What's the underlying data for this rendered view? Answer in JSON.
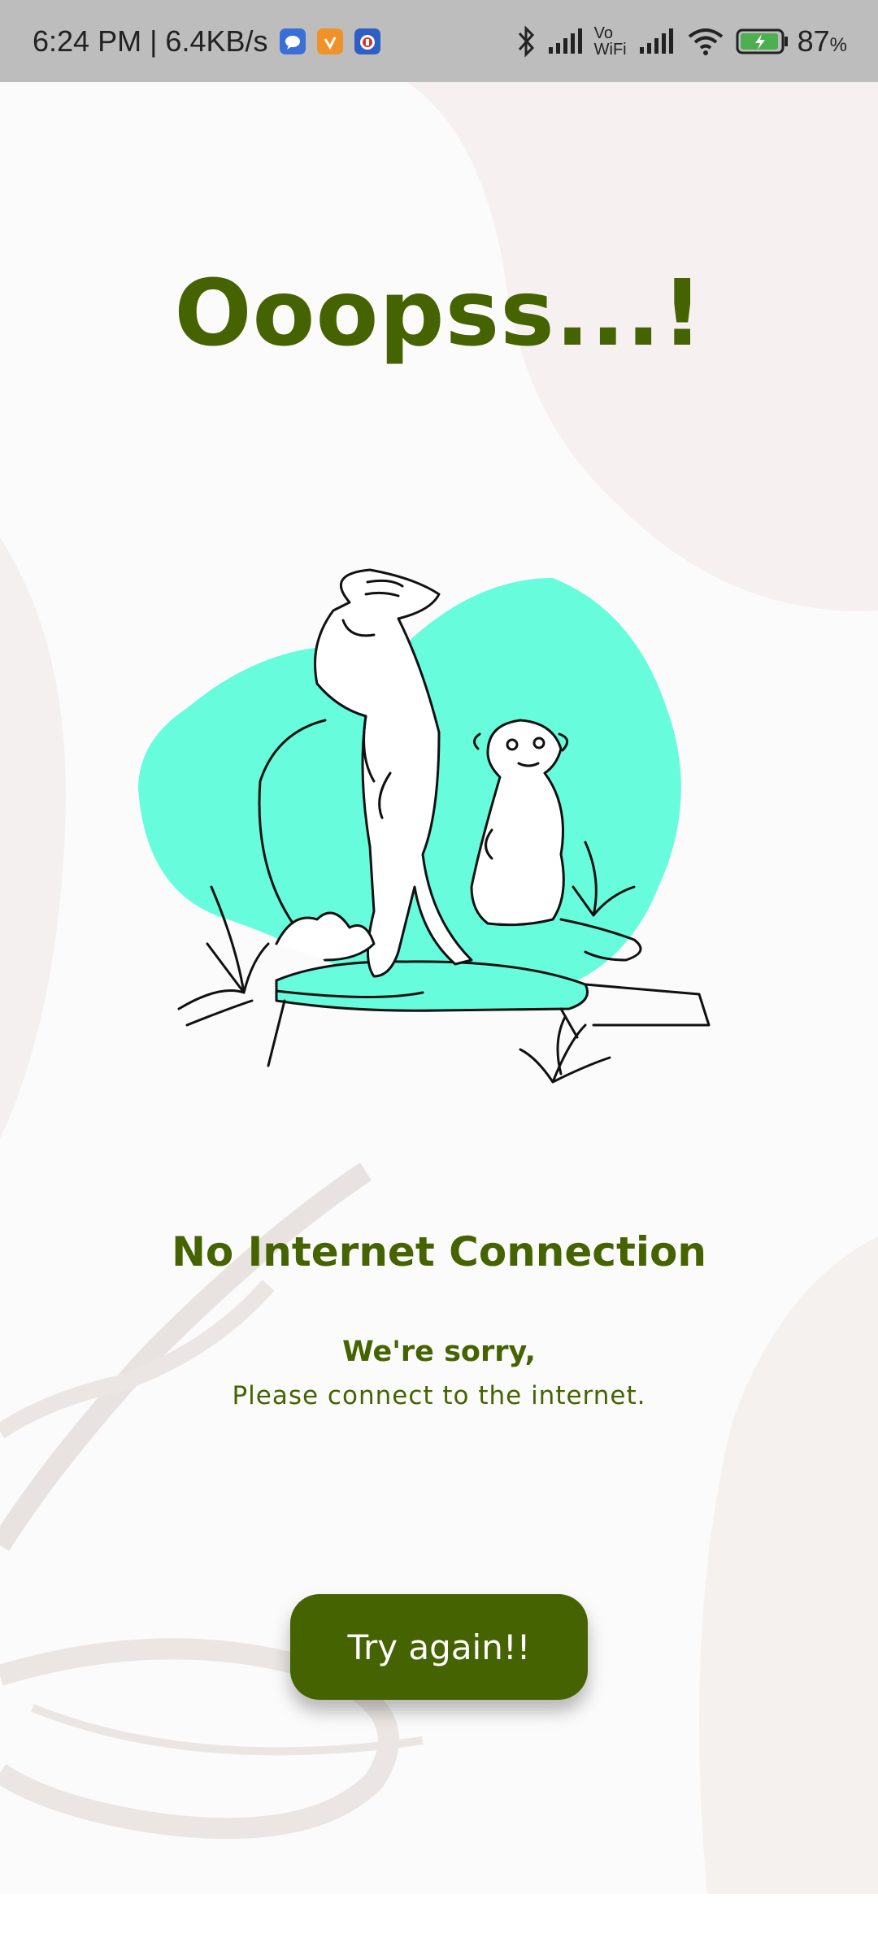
{
  "status_bar": {
    "time_speed": "6:24 PM | 6.4KB/s",
    "battery_percent": "87",
    "battery_unit": "%",
    "vo_wifi_top": "Vo",
    "vo_wifi_bottom": "WiFi",
    "icons": [
      "messages-icon",
      "orange-app-icon",
      "red-app-icon",
      "bluetooth-icon",
      "signal-icon",
      "vowifi-icon",
      "signal-icon",
      "wifi-icon",
      "battery-charging-icon"
    ]
  },
  "error": {
    "title": "Ooopss...!",
    "heading": "No Internet Connection",
    "apology": "We're sorry,",
    "message": "Please connect to the internet.",
    "retry_label": "Try again!!"
  },
  "colors": {
    "brand_green": "#456300",
    "blob_mint": "#67fcdb",
    "status_bar_bg": "#bdbdbd"
  }
}
